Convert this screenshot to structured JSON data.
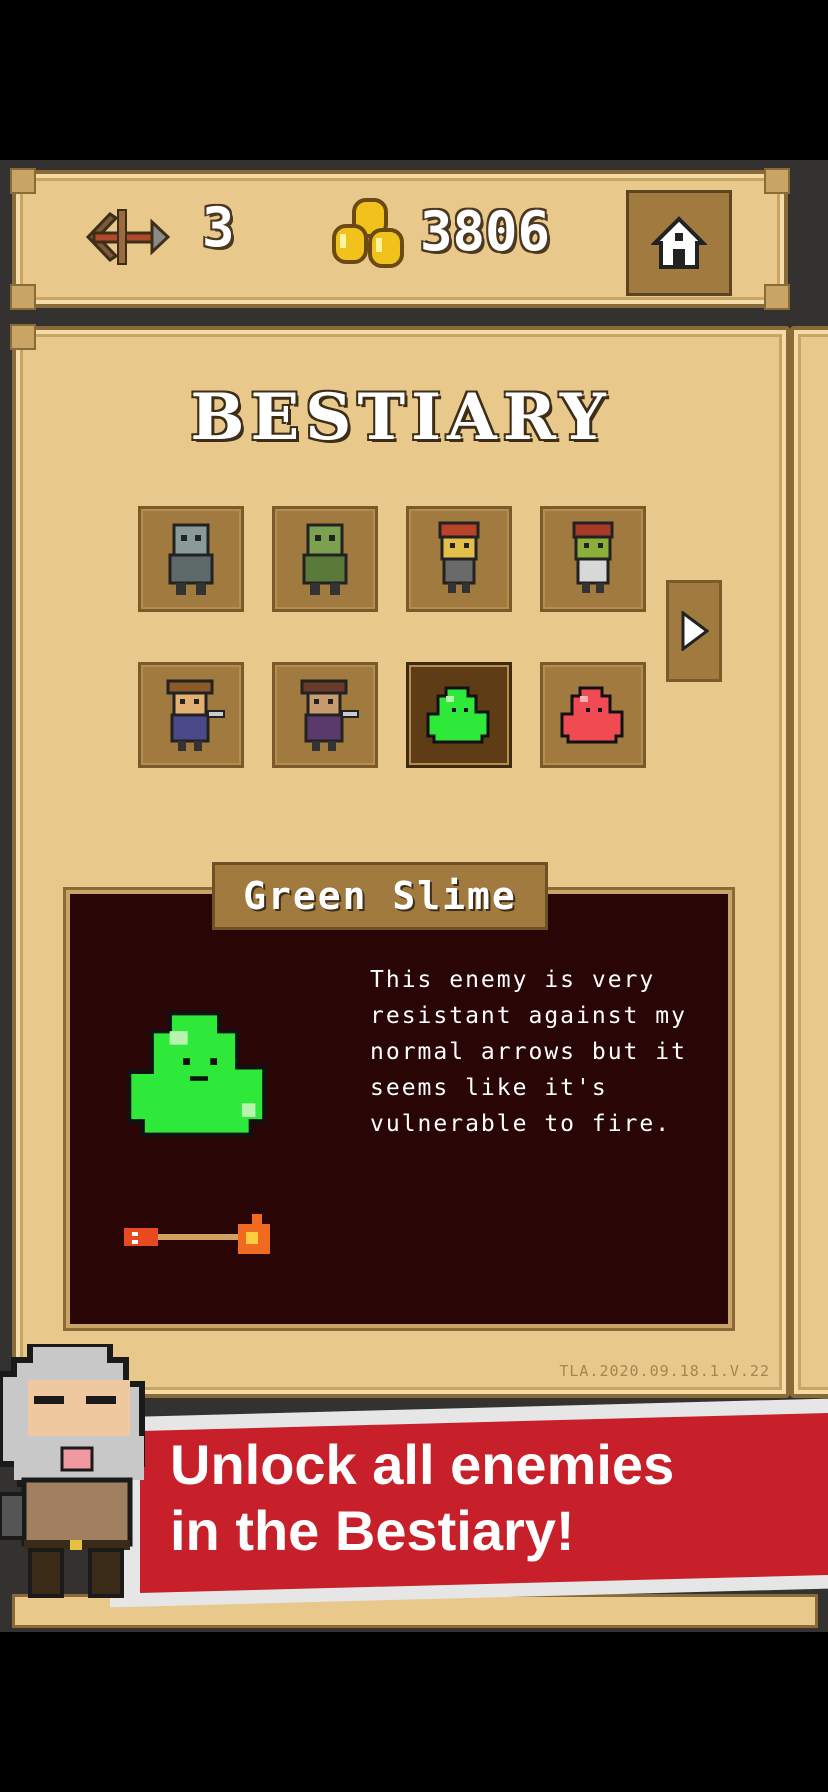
{
  "hud": {
    "arrows_count": "3",
    "gold_count": "3806"
  },
  "bestiary": {
    "title": "BESTIARY",
    "monsters": [
      {
        "id": "grey-zombie",
        "selected": false
      },
      {
        "id": "green-zombie",
        "selected": false
      },
      {
        "id": "red-haired-goblin",
        "selected": false
      },
      {
        "id": "green-goblin",
        "selected": false
      },
      {
        "id": "bandit",
        "selected": false
      },
      {
        "id": "dark-bandit",
        "selected": false
      },
      {
        "id": "green-slime",
        "selected": true
      },
      {
        "id": "red-slime",
        "selected": false
      }
    ],
    "selected": {
      "name": "Green Slime",
      "description": "This enemy is very resistant against my normal arrows but it seems like it's vulnerable to fire."
    },
    "version": "TLA.2020.09.18.1.V.22"
  },
  "banner": {
    "line1": "Unlock all enemies",
    "line2": "in the Bestiary!"
  },
  "colors": {
    "parchment": "#e8c88b",
    "slot": "#a07a3e",
    "info_bg": "#2a0505",
    "slime": "#2ee83a",
    "banner_red": "#c8202a"
  },
  "icons": [
    "crossbow-icon",
    "gold-coins-icon",
    "home-icon",
    "next-arrow-icon",
    "fire-arrow-icon"
  ]
}
